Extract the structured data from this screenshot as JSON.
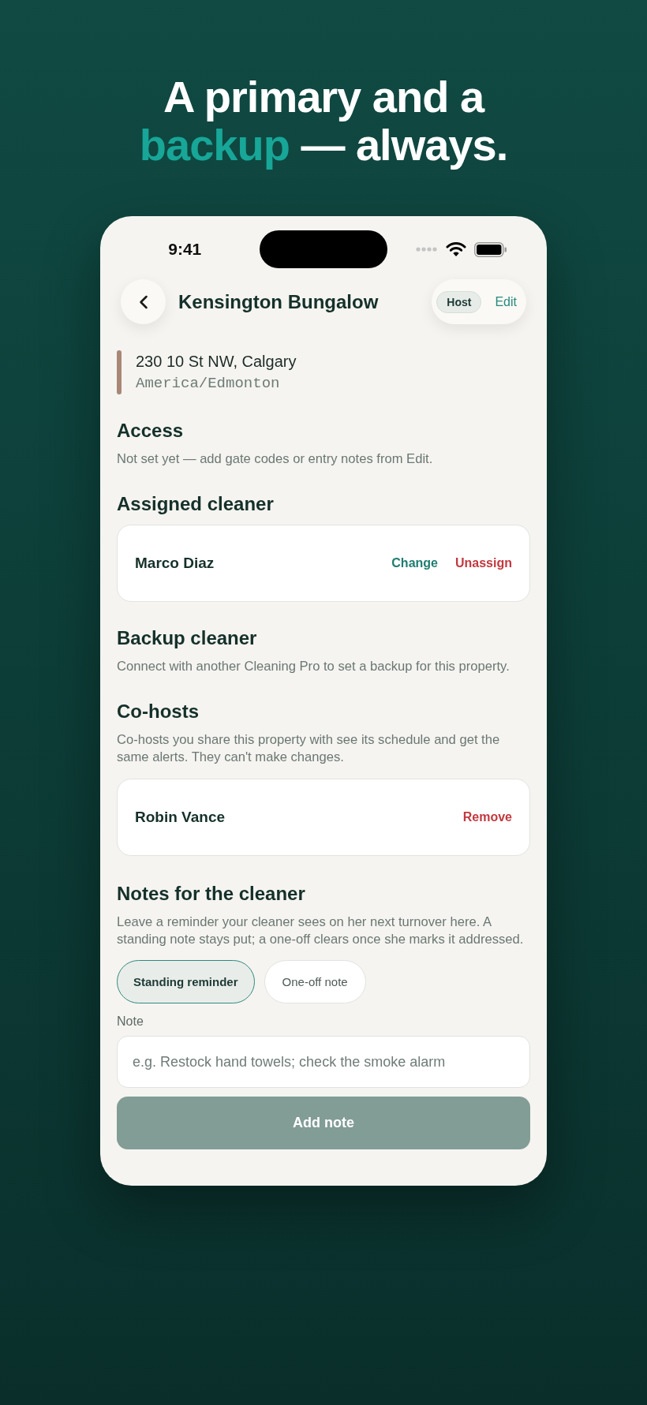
{
  "headline": "A primary and a **backup** — always.",
  "status_bar": {
    "time": "9:41"
  },
  "header": {
    "title": "Kensington Bungalow",
    "role_badge": "Host",
    "edit_label": "Edit"
  },
  "property": {
    "address": "230 10 St NW, Calgary",
    "timezone": "America/Edmonton"
  },
  "sections": [
    {
      "kind": "text",
      "title": "Access",
      "description": "Not set yet — add gate codes or entry notes from Edit."
    },
    {
      "kind": "people",
      "title": "Assigned cleaner",
      "people": [
        {
          "name": "Marco Diaz",
          "actions": [
            {
              "label": "Change",
              "color": "#1f7d71"
            },
            {
              "label": "Unassign",
              "color": "#c2383f"
            }
          ]
        }
      ]
    },
    {
      "kind": "text",
      "title": "Backup cleaner",
      "description": "Connect with another Cleaning Pro to set a backup for this property."
    },
    {
      "kind": "people",
      "title": "Co-hosts",
      "description": "Co-hosts you share this property with see its schedule and get the same alerts. They can't make changes.",
      "people": [
        {
          "name": "Robin Vance",
          "actions": [
            {
              "label": "Remove",
              "color": "#c2383f"
            }
          ]
        }
      ]
    },
    {
      "kind": "notes",
      "title": "Notes for the cleaner",
      "description": "Leave a reminder your cleaner sees on her next turnover here. A standing note stays put; a one-off clears once she marks it addressed.",
      "note_types": [
        {
          "label": "Standing reminder",
          "selected": true
        },
        {
          "label": "One-off note",
          "selected": false
        }
      ],
      "field": {
        "label": "Note",
        "placeholder": "e.g. Restock hand towels; check the smoke alarm"
      },
      "submit": {
        "label": "Add note",
        "disabled": true
      }
    }
  ]
}
